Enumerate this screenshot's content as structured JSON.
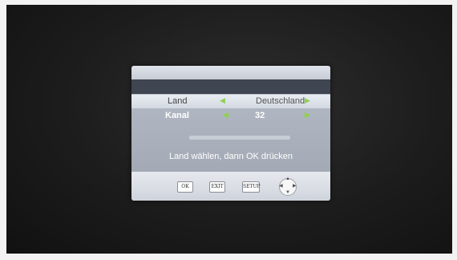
{
  "menu": {
    "rows": [
      {
        "label": "Land",
        "value": "Deutschland",
        "left_arrow": "◀",
        "right_arrow": "▶"
      },
      {
        "label": "Kanal",
        "value": "32",
        "left_arrow": "◀",
        "right_arrow": "▶"
      }
    ],
    "scan_progress": 0.0,
    "hint": "Land wählen, dann OK drücken"
  },
  "buttons": {
    "ok": "OK",
    "exit": "EXIT",
    "setup": "SETUP"
  },
  "dpad": {
    "up": "▲",
    "down": "▼",
    "left": "◀",
    "right": "▶"
  },
  "colors": {
    "arrow": "#8fd14f",
    "highlight_row": "#e9edf3",
    "dialog": "#a7aeb9"
  }
}
